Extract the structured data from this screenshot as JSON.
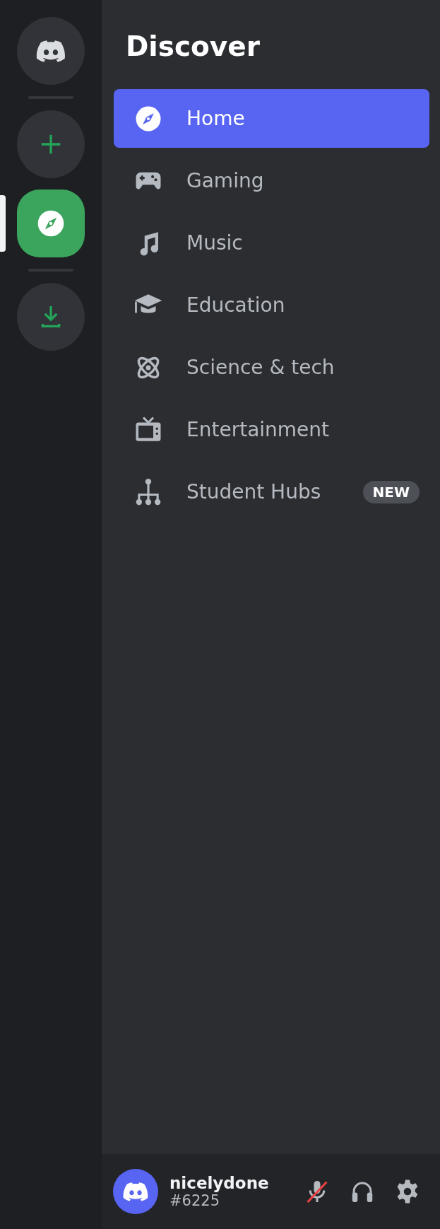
{
  "server_rail": [
    {
      "kind": "home",
      "selected": false
    },
    {
      "kind": "add",
      "selected": false
    },
    {
      "kind": "explore",
      "selected": true
    },
    {
      "kind": "download",
      "selected": false
    }
  ],
  "sidebar": {
    "title": "Discover",
    "items": [
      {
        "kind": "compass",
        "label": "Home",
        "selected": true
      },
      {
        "kind": "gamepad",
        "label": "Gaming",
        "selected": false
      },
      {
        "kind": "music",
        "label": "Music",
        "selected": false
      },
      {
        "kind": "cap",
        "label": "Education",
        "selected": false
      },
      {
        "kind": "atom",
        "label": "Science & tech",
        "selected": false
      },
      {
        "kind": "tv",
        "label": "Entertainment",
        "selected": false
      },
      {
        "kind": "hub",
        "label": "Student Hubs",
        "selected": false,
        "badge": "NEW"
      }
    ]
  },
  "user_panel": {
    "username": "nicelydone",
    "tag": "#6225",
    "muted": true,
    "deafened": false
  }
}
